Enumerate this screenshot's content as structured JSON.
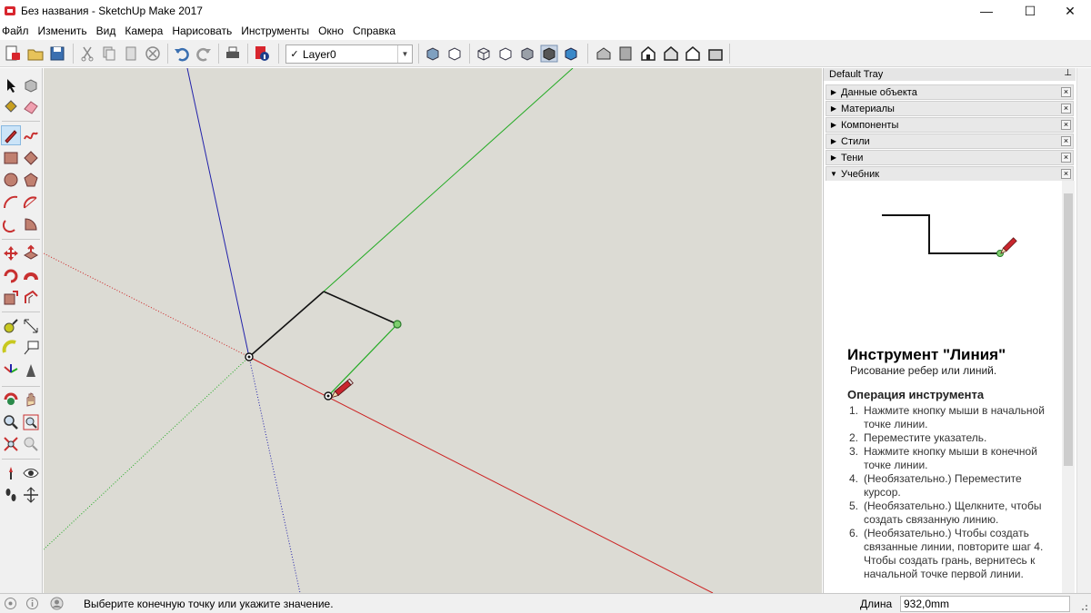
{
  "window": {
    "title": "Без названия - SketchUp Make 2017",
    "minimize": "—",
    "maximize": "☐",
    "close": "✕"
  },
  "menu": [
    "Файл",
    "Изменить",
    "Вид",
    "Камера",
    "Нарисовать",
    "Инструменты",
    "Окно",
    "Справка"
  ],
  "toolbar": {
    "layer": {
      "check": "✓",
      "name": "Layer0",
      "arrow": "▼"
    }
  },
  "tray": {
    "title": "Default Tray",
    "pin": "⊥",
    "panels": [
      {
        "label": "Данные объекта",
        "expanded": false
      },
      {
        "label": "Материалы",
        "expanded": false
      },
      {
        "label": "Компоненты",
        "expanded": false
      },
      {
        "label": "Стили",
        "expanded": false
      },
      {
        "label": "Тени",
        "expanded": false
      },
      {
        "label": "Учебник",
        "expanded": true
      }
    ],
    "collapsed_arrow": "▶",
    "expanded_arrow": "▼",
    "close_glyph": "×",
    "tutorial": {
      "title": "Инструмент \"Линия\"",
      "subtitle": "Рисование ребер или линий.",
      "op_heading": "Операция инструмента",
      "steps": [
        {
          "num": "1.",
          "text": "Нажмите кнопку мыши в начальной точке линии."
        },
        {
          "num": "2.",
          "text": "Переместите указатель."
        },
        {
          "num": "3.",
          "text": "Нажмите кнопку мыши в конечной точке линии."
        },
        {
          "num": "4.",
          "text": "(Необязательно.) Переместите курсор."
        },
        {
          "num": "5.",
          "text": "(Необязательно.) Щелкните, чтобы создать связанную линию."
        },
        {
          "num": "6.",
          "text": "(Необязательно.) Чтобы создать связанные линии, повторите шаг 4. Чтобы создать грань, вернитесь к начальной точке первой линии."
        }
      ]
    }
  },
  "status": {
    "message": "Выберите конечную точку или укажите значение.",
    "vcb_label": "Длина",
    "vcb_value": "932,0mm"
  },
  "colors": {
    "axis_red": "#cc2222",
    "axis_green": "#22aa22",
    "axis_blue": "#2222aa",
    "background": "#dcdbd4"
  }
}
